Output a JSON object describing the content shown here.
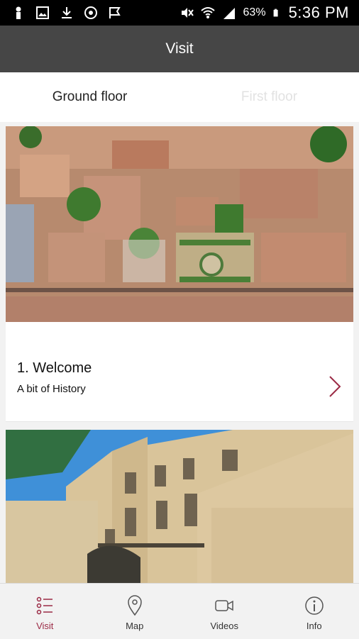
{
  "status_bar": {
    "battery": "63%",
    "time": "5:36 PM"
  },
  "app_bar": {
    "title": "Visit"
  },
  "tabs": [
    {
      "label": "Ground floor",
      "active": true
    },
    {
      "label": "First floor",
      "active": false
    }
  ],
  "cards": [
    {
      "number_title": "1. Welcome",
      "subtitle": "A bit of History",
      "image": "aerial-view-photo"
    },
    {
      "image": "building-facade-photo"
    }
  ],
  "bottom_nav": [
    {
      "label": "Visit",
      "icon": "list-icon",
      "active": true
    },
    {
      "label": "Map",
      "icon": "map-pin-icon",
      "active": false
    },
    {
      "label": "Videos",
      "icon": "video-camera-icon",
      "active": false
    },
    {
      "label": "Info",
      "icon": "info-icon",
      "active": false
    }
  ],
  "colors": {
    "app_bar": "#464646",
    "accent": "#9b2a45",
    "tab_inactive": "#e2e2e2"
  }
}
